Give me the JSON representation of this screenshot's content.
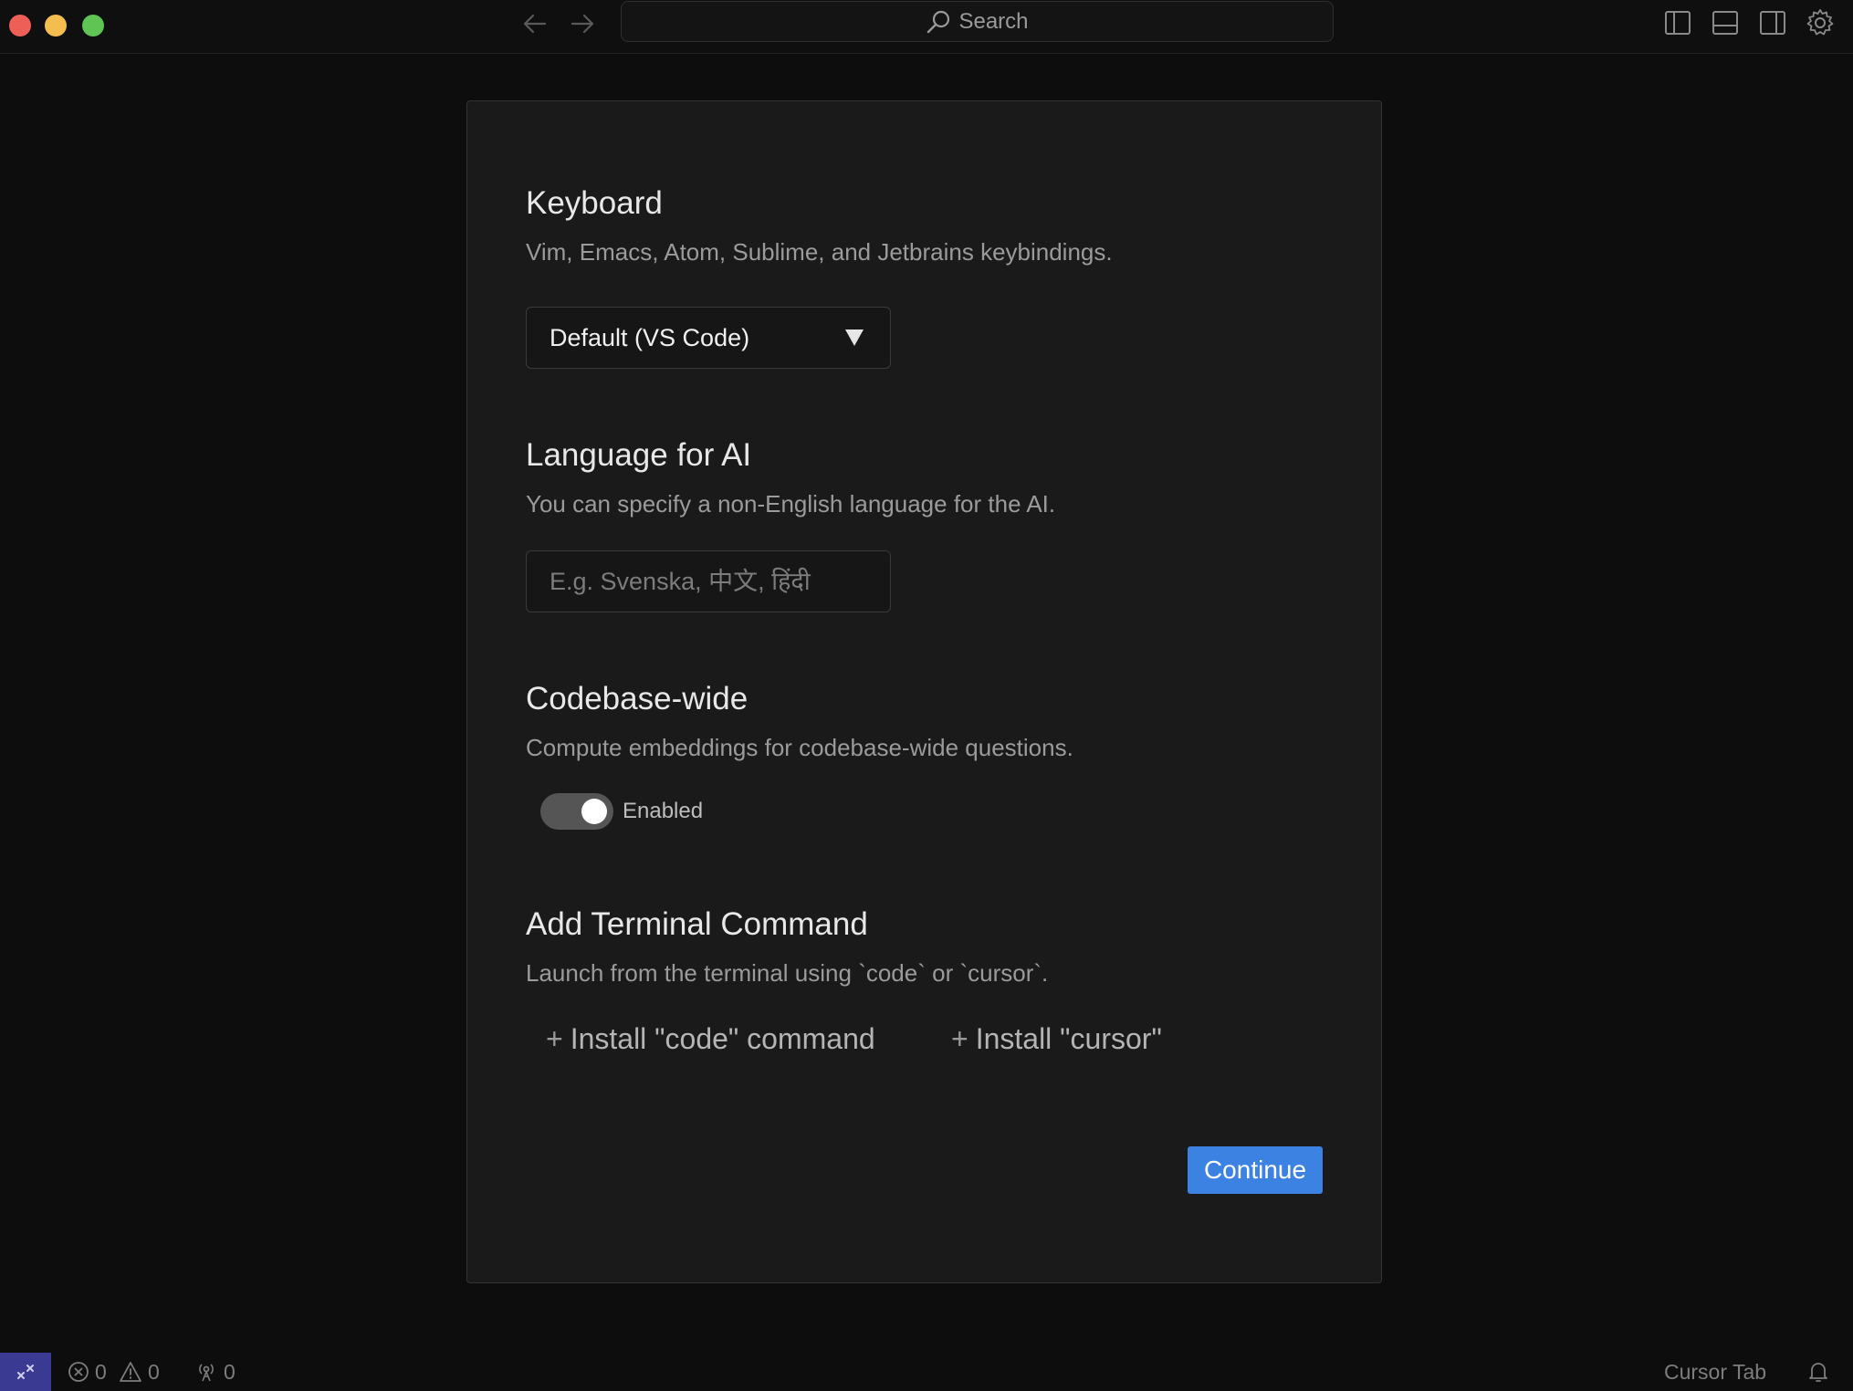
{
  "titlebar": {
    "search_label": "Search",
    "icons": [
      "chevron-left-icon",
      "chevron-right-icon",
      "search-icon",
      "sidebar-left-icon",
      "panel-bottom-icon",
      "sidebar-right-icon",
      "gear-icon"
    ]
  },
  "keyboard": {
    "title": "Keyboard",
    "description": "Vim, Emacs, Atom, Sublime, and Jetbrains keybindings.",
    "selected": "Default (VS Code)"
  },
  "language": {
    "title": "Language for AI",
    "description": "You can specify a non-English language for the AI.",
    "placeholder": "E.g. Svenska, 中文, हिंदी",
    "value": ""
  },
  "codebase": {
    "title": "Codebase-wide",
    "description": "Compute embeddings for codebase-wide questions.",
    "toggle_label": "Enabled",
    "enabled": true
  },
  "terminal": {
    "title": "Add Terminal Command",
    "description": "Launch from the terminal using `code` or `cursor`.",
    "install_code": "Install \"code\" command",
    "install_cursor": "Install \"cursor\""
  },
  "continue_label": "Continue",
  "statusbar": {
    "errors": "0",
    "warnings": "0",
    "ports": "0",
    "cursor_tab": "Cursor Tab"
  },
  "colors": {
    "accent": "#3c82e3",
    "remote": "#3b3a93",
    "background": "#0d0d0d",
    "panel": "#1a1a1a"
  }
}
